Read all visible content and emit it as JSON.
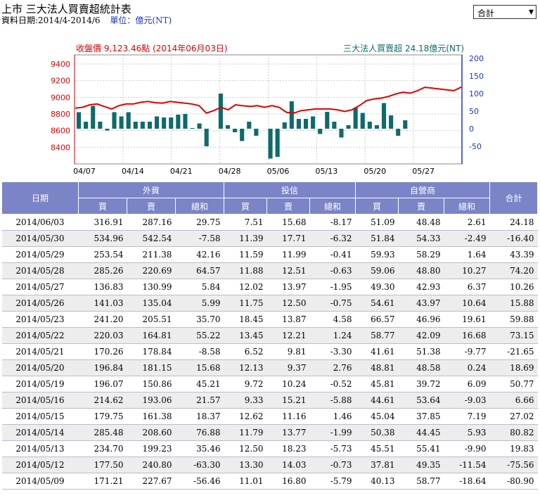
{
  "header": {
    "title": "上市 三大法人買賣超統計表",
    "date_range": "資料日期:2014/4-2014/6",
    "unit": "單位：億元(NT)"
  },
  "selector": {
    "value": "合計"
  },
  "chart_data": {
    "type": "line",
    "left_label": "收盤價 9,123.46點 (2014年06月03日)",
    "right_label": "三大法人買賣超 24.18億元(NT)",
    "left_axis": {
      "ticks": [
        9400,
        9200,
        9000,
        8800,
        8600,
        8400
      ],
      "ylim": [
        8200,
        9510
      ]
    },
    "right_axis": {
      "ticks": [
        200,
        150,
        100,
        50,
        0,
        -50
      ],
      "ylim": [
        -100,
        210
      ]
    },
    "x_labels": [
      "04/07",
      "04/14",
      "04/21",
      "04/28",
      "05/06",
      "05/13",
      "05/20",
      "05/27"
    ],
    "grid": true,
    "series": [
      {
        "type": "line",
        "color": "#e00000",
        "values": [
          8870,
          8880,
          8910,
          8920,
          8890,
          8860,
          8900,
          8920,
          8920,
          8940,
          8950,
          8935,
          8930,
          8950,
          8940,
          8930,
          8920,
          8900,
          8810,
          8840,
          8880,
          8850,
          8910,
          8900,
          8890,
          8900,
          8880,
          8900,
          8880,
          8820,
          8810,
          8840,
          8850,
          8860,
          8860,
          8860,
          8850,
          8830,
          8850,
          8900,
          8960,
          8980,
          8990,
          9010,
          9040,
          9060,
          9050,
          9080,
          9120,
          9110,
          9100,
          9090,
          9080,
          9123
        ]
      },
      {
        "type": "bar",
        "color": "#0d6b6b",
        "values": [
          47,
          20,
          65,
          20,
          -5,
          47,
          35,
          47,
          20,
          20,
          20,
          35,
          32,
          32,
          40,
          42,
          2,
          15,
          -50,
          0,
          100,
          10,
          -10,
          -35,
          20,
          -20,
          0,
          -85,
          -80,
          18,
          78,
          28,
          28,
          35,
          -15,
          48,
          20,
          -25,
          10,
          60,
          45,
          20,
          10,
          73,
          38,
          -20,
          24,
          0,
          0,
          0,
          0,
          0,
          0,
          0
        ]
      }
    ]
  },
  "table": {
    "group_headers": [
      "日期",
      "外資",
      "投信",
      "自營商",
      "合計"
    ],
    "sub_headers": [
      "買",
      "賣",
      "總和",
      "買",
      "賣",
      "總和",
      "買",
      "賣",
      "總和"
    ],
    "rows": [
      [
        "2014/06/03",
        "316.91",
        "287.16",
        "29.75",
        "7.51",
        "15.68",
        "-8.17",
        "51.09",
        "48.48",
        "2.61",
        "24.18"
      ],
      [
        "2014/05/30",
        "534.96",
        "542.54",
        "-7.58",
        "11.39",
        "17.71",
        "-6.32",
        "51.84",
        "54.33",
        "-2.49",
        "-16.40"
      ],
      [
        "2014/05/29",
        "253.54",
        "211.38",
        "42.16",
        "11.59",
        "11.99",
        "-0.41",
        "59.93",
        "58.29",
        "1.64",
        "43.39"
      ],
      [
        "2014/05/28",
        "285.26",
        "220.69",
        "64.57",
        "11.88",
        "12.51",
        "-0.63",
        "59.06",
        "48.80",
        "10.27",
        "74.20"
      ],
      [
        "2014/05/27",
        "136.83",
        "130.99",
        "5.84",
        "12.02",
        "13.97",
        "-1.95",
        "49.30",
        "42.93",
        "6.37",
        "10.26"
      ],
      [
        "2014/05/26",
        "141.03",
        "135.04",
        "5.99",
        "11.75",
        "12.50",
        "-0.75",
        "54.61",
        "43.97",
        "10.64",
        "15.88"
      ],
      [
        "2014/05/23",
        "241.20",
        "205.51",
        "35.70",
        "18.45",
        "13.87",
        "4.58",
        "66.57",
        "46.96",
        "19.61",
        "59.88"
      ],
      [
        "2014/05/22",
        "220.03",
        "164.81",
        "55.22",
        "13.45",
        "12.21",
        "1.24",
        "58.77",
        "42.09",
        "16.68",
        "73.15"
      ],
      [
        "2014/05/21",
        "170.26",
        "178.84",
        "-8.58",
        "6.52",
        "9.81",
        "-3.30",
        "41.61",
        "51.38",
        "-9.77",
        "-21.65"
      ],
      [
        "2014/05/20",
        "196.84",
        "181.15",
        "15.68",
        "12.13",
        "9.37",
        "2.76",
        "48.81",
        "48.58",
        "0.24",
        "18.69"
      ],
      [
        "2014/05/19",
        "196.07",
        "150.86",
        "45.21",
        "9.72",
        "10.24",
        "-0.52",
        "45.81",
        "39.72",
        "6.09",
        "50.77"
      ],
      [
        "2014/05/16",
        "214.62",
        "193.06",
        "21.57",
        "9.33",
        "15.21",
        "-5.88",
        "44.61",
        "53.64",
        "-9.03",
        "6.66"
      ],
      [
        "2014/05/15",
        "179.75",
        "161.38",
        "18.37",
        "12.62",
        "11.16",
        "1.46",
        "45.04",
        "37.85",
        "7.19",
        "27.02"
      ],
      [
        "2014/05/14",
        "285.48",
        "208.60",
        "76.88",
        "11.79",
        "13.77",
        "-1.99",
        "50.38",
        "44.45",
        "5.93",
        "80.82"
      ],
      [
        "2014/05/13",
        "234.70",
        "199.23",
        "35.46",
        "12.50",
        "18.23",
        "-5.73",
        "45.51",
        "55.41",
        "-9.90",
        "19.83"
      ],
      [
        "2014/05/12",
        "177.50",
        "240.80",
        "-63.30",
        "13.30",
        "14.03",
        "-0.73",
        "37.81",
        "49.35",
        "-11.54",
        "-75.56"
      ],
      [
        "2014/05/09",
        "171.21",
        "227.67",
        "-56.46",
        "11.01",
        "16.80",
        "-5.79",
        "40.13",
        "58.77",
        "-18.64",
        "-80.90"
      ]
    ]
  }
}
